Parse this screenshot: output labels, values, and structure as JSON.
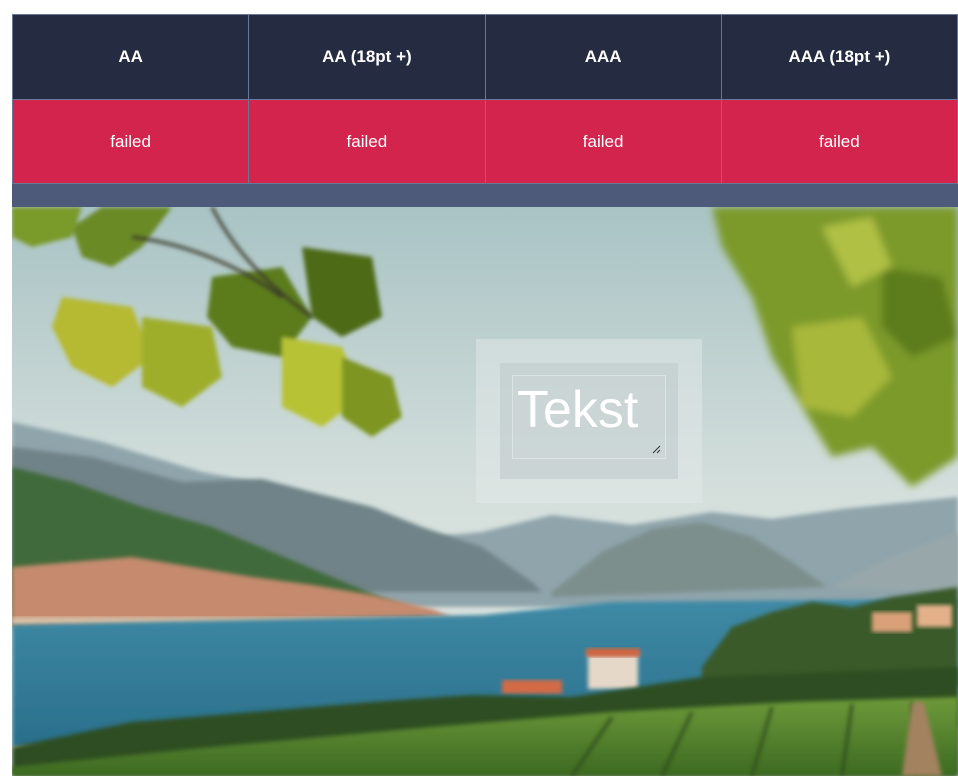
{
  "contrast_table": {
    "headers": [
      "AA",
      "AA (18pt +)",
      "AAA",
      "AAA (18pt +)"
    ],
    "results": [
      "failed",
      "failed",
      "failed",
      "failed"
    ]
  },
  "preview": {
    "text_value": "Tekst",
    "background_image": "vineyard-lake-landscape"
  },
  "colors": {
    "header_bg": "#252c41",
    "failed_bg": "#d2244d",
    "frame_bg": "#4d5a7a"
  },
  "icons": {
    "resize": "resize-grip-icon"
  }
}
